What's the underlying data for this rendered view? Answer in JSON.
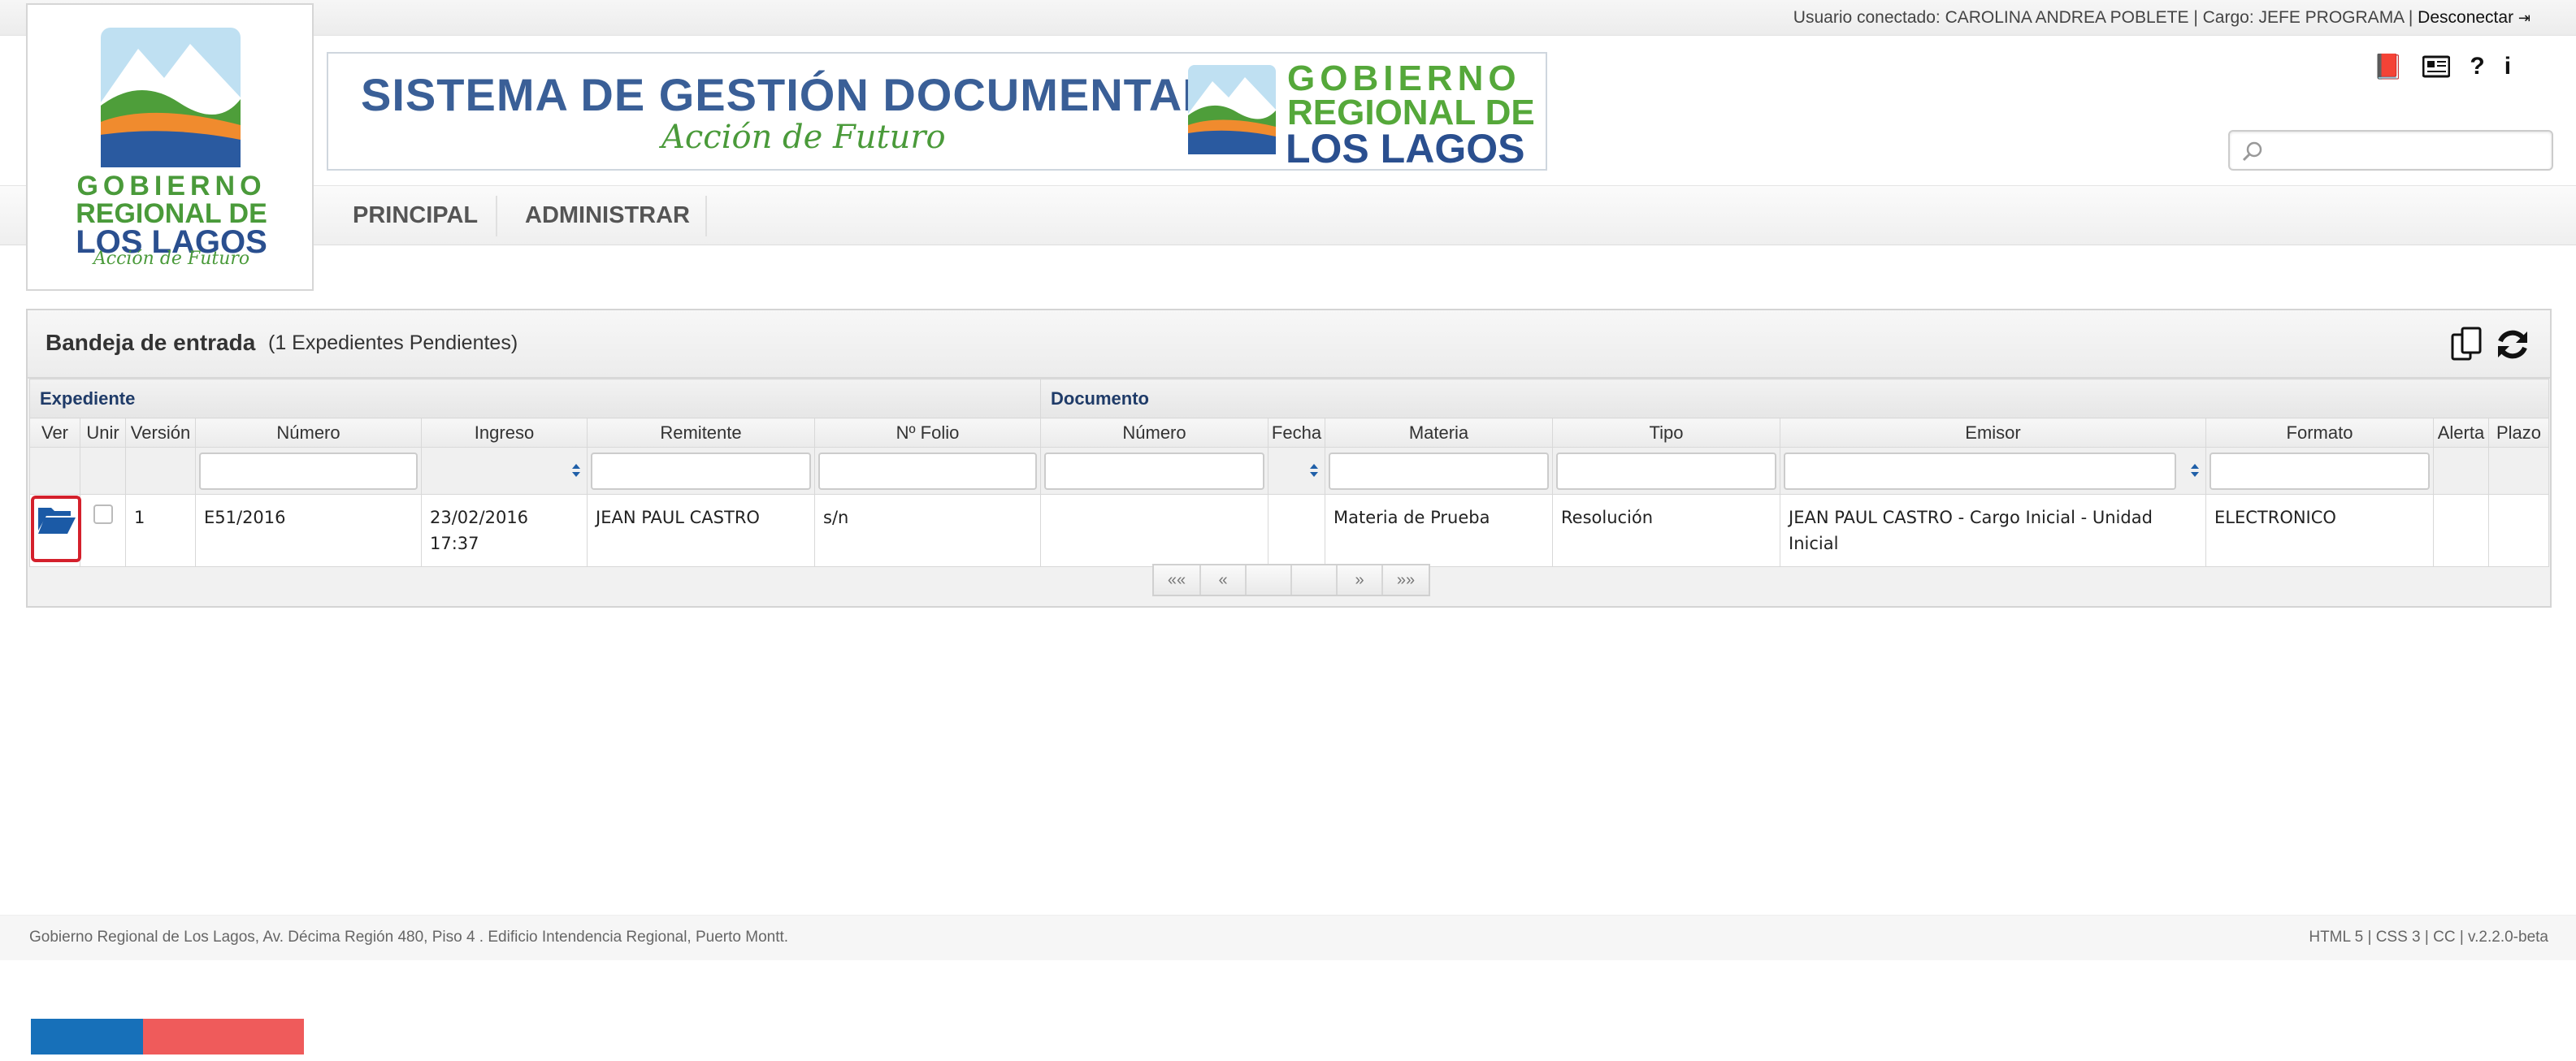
{
  "topbar": {
    "user_label": "Usuario conectado: CAROLINA ANDREA POBLETE | Cargo: JEFE PROGRAMA |",
    "logout_label": "Desconectar"
  },
  "banner": {
    "title": "SISTEMA DE GESTIÓN DOCUMENTAL",
    "slogan": "Acción de Futuro",
    "org_line1": "GOBIERNO",
    "org_line2": "REGIONAL DE",
    "org_line3": "LOS LAGOS"
  },
  "logo": {
    "line1": "GOBIERNO",
    "line2": "REGIONAL DE",
    "line3": "LOS LAGOS",
    "line4": "Acción de Futuro"
  },
  "toolbar_icons": [
    "book-icon",
    "news-icon",
    "help-icon",
    "info-icon"
  ],
  "search": {
    "placeholder": ""
  },
  "nav": {
    "items": [
      "PRINCIPAL",
      "ADMINISTRAR"
    ]
  },
  "panel": {
    "title": "Bandeja de entrada",
    "count": "(1 Expedientes Pendientes)",
    "groups": {
      "expediente": "Expediente",
      "documento": "Documento"
    },
    "columns": [
      "Ver",
      "Unir",
      "Versión",
      "Número",
      "Ingreso",
      "Remitente",
      "Nº Folio",
      "Número",
      "Fecha",
      "Materia",
      "Tipo",
      "Emisor",
      "Formato",
      "Alerta",
      "Plazo"
    ],
    "rows": [
      {
        "version": "1",
        "numero": "E51/2016",
        "ingreso": "23/02/2016 17:37",
        "remitente": "JEAN PAUL CASTRO",
        "folio": "s/n",
        "doc_numero": "",
        "fecha": "",
        "materia": "Materia de Prueba",
        "tipo": "Resolución",
        "emisor": "JEAN PAUL CASTRO - Cargo Inicial - Unidad Inicial",
        "formato": "ELECTRONICO",
        "alerta": "",
        "plazo": ""
      }
    ],
    "pager": [
      "««",
      "«",
      "",
      "",
      "»",
      "»»"
    ]
  },
  "footer": {
    "address": "Gobierno Regional de Los Lagos, Av. Décima Región 480, Piso 4 . Edificio Intendencia Regional, Puerto Montt.",
    "version": "HTML 5 | CSS 3 | CC | v.2.2.0-beta"
  },
  "colors": {
    "accent_blue": "#1f3b68",
    "folder_blue": "#1b5aa6",
    "highlight_red": "#d4202c",
    "flag_blue": "#1770b9",
    "flag_red": "#ef5b5b"
  }
}
